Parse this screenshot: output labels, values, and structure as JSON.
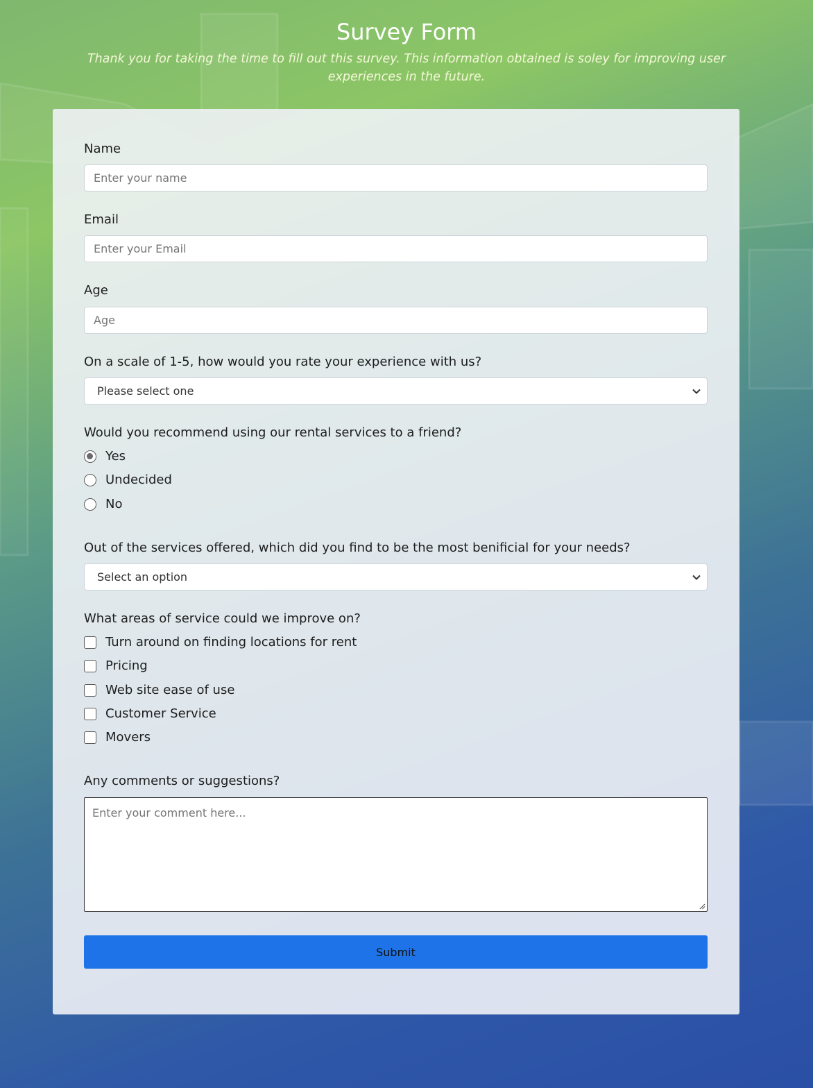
{
  "header": {
    "title": "Survey Form",
    "description": "Thank you for taking the time to fill out this survey. This information obtained is soley for improving user experiences in the future."
  },
  "form": {
    "name": {
      "label": "Name",
      "placeholder": "Enter your name"
    },
    "email": {
      "label": "Email",
      "placeholder": "Enter your Email"
    },
    "age": {
      "label": "Age",
      "placeholder": "Age"
    },
    "rating": {
      "label": "On a scale of 1-5, how would you rate your experience with us?",
      "selected": "Please select one"
    },
    "recommend": {
      "label": "Would you recommend using our rental services to a friend?",
      "options": [
        {
          "label": "Yes",
          "checked": true
        },
        {
          "label": "Undecided",
          "checked": false
        },
        {
          "label": "No",
          "checked": false
        }
      ]
    },
    "services": {
      "label": "Out of the services offered, which did you find to be the most benificial for your needs?",
      "selected": "Select an option"
    },
    "improve": {
      "label": "What areas of service could we improve on?",
      "options": [
        {
          "label": "Turn around on finding locations for rent",
          "checked": false
        },
        {
          "label": "Pricing",
          "checked": false
        },
        {
          "label": "Web site ease of use",
          "checked": false
        },
        {
          "label": "Customer Service",
          "checked": false
        },
        {
          "label": "Movers",
          "checked": false
        }
      ]
    },
    "comments": {
      "label": "Any comments or suggestions?",
      "placeholder": "Enter your comment here..."
    },
    "submit_label": "Submit"
  },
  "colors": {
    "accent": "#1e73e8",
    "gradient_top": "#8cc665",
    "gradient_bottom": "#2a4fa6"
  }
}
